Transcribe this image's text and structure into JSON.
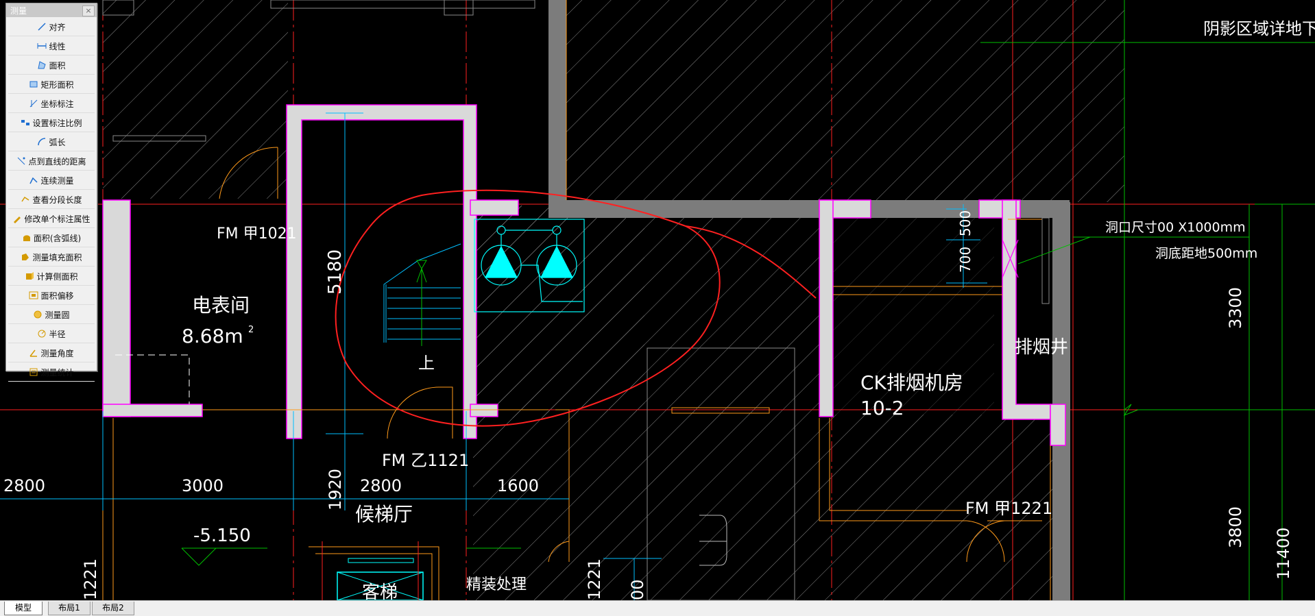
{
  "palette": {
    "title": "测量",
    "close": "×",
    "items": [
      "对齐",
      "线性",
      "面积",
      "矩形面积",
      "坐标标注",
      "设置标注比例",
      "弧长",
      "点到直线的距离",
      "连续测量",
      "查看分段长度",
      "修改单个标注属性",
      "面积(含弧线)",
      "测量填充面积",
      "计算侧面积",
      "面积偏移",
      "测量圆",
      "半径",
      "测量角度",
      "测量统计"
    ]
  },
  "tabs": [
    "模型",
    "布局1",
    "布局2"
  ],
  "drawing": {
    "header_note": "阴影区域详地下",
    "door_fm_a1021": "FM 甲1021",
    "room_meter": "电表间",
    "meter_area": "8.68m",
    "area_sup": "2",
    "dim_5180": "5180",
    "stair_up": "上",
    "door_fm_b1121": "FM 乙1121",
    "dim_2800_left": "2800",
    "dim_3000": "3000",
    "dim_1920": "1920",
    "dim_2800_mid": "2800",
    "dim_1600": "1600",
    "lobby": "候梯厅",
    "elev_level": "-5.150",
    "guest_elev": "客梯",
    "finish_note": "精装处理",
    "left_cut_num": "1221",
    "mid_cut_num": "1221",
    "mid_cut_dim": "00",
    "room_fan": "CK排烟机房",
    "room_fan_num": "10-2",
    "door_fm_a1221": "FM 甲1221",
    "smoke_shaft": "排烟井",
    "dim_500": "500",
    "dim_700": "700",
    "opening_size": "洞口尺寸00   X1000mm",
    "opening_height": "洞底距地500mm",
    "dim_3300": "3300",
    "dim_3800": "3800",
    "dim_11400": "11400"
  },
  "colors": {
    "background": "#000000",
    "wall_fill": "#d9d9d9",
    "wall_outline": "#ff00ff",
    "axis": "#ff2020",
    "dim": "#00bfff",
    "hatch": "#ffffff",
    "markup": "#ff2020",
    "equipment": "#00ffff",
    "door": "#ff9a1a",
    "green": "#00c000"
  }
}
